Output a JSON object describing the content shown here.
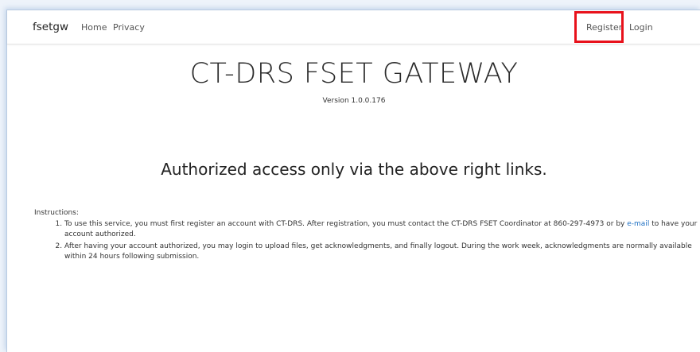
{
  "navbar": {
    "brand": "fsetgw",
    "home": "Home",
    "privacy": "Privacy",
    "register": "Register",
    "login": "Login"
  },
  "main": {
    "title": "CT-DRS FSET GATEWAY",
    "version": "Version 1.0.0.176",
    "headline": "Authorized access only via the above right links."
  },
  "instructions": {
    "label": "Instructions:",
    "item1_before": "To use this service, you must first register an account with CT-DRS. After registration, you must contact the CT-DRS FSET Coordinator at 860-297-4973 or by ",
    "item1_link": "e-mail",
    "item1_after": " to have your account authorized.",
    "item2": "After having your account authorized, you may login to upload files, get acknowledgments, and finally logout. During the work week, acknowledgments are normally available within 24 hours following submission."
  },
  "colors": {
    "highlight": "#e8111b",
    "link": "#1b6ec2"
  }
}
